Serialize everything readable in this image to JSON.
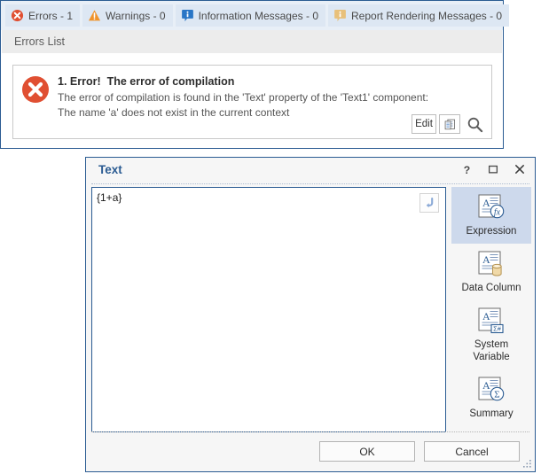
{
  "errors_panel": {
    "tabs": [
      {
        "id": "errors",
        "label": "Errors - 1",
        "icon": "error-circle-icon",
        "active": true
      },
      {
        "id": "warnings",
        "label": "Warnings - 0",
        "icon": "warning-triangle-icon",
        "active": false
      },
      {
        "id": "information",
        "label": "Information Messages - 0",
        "icon": "info-bubble-blue-icon",
        "active": false
      },
      {
        "id": "rendering",
        "label": "Report Rendering Messages - 0",
        "icon": "info-bubble-orange-icon",
        "active": false
      }
    ],
    "section_title": "Errors List",
    "error": {
      "title": "1. Error!  The error of compilation",
      "line1": "The error of compilation is found in the 'Text' property of the 'Text1' component:",
      "line2": "The name 'a' does not exist in the current context",
      "edit_label": "Edit",
      "copy_icon": "copy-document-icon",
      "find_icon": "magnifier-search-icon"
    }
  },
  "dialog": {
    "title": "Text",
    "help_glyph": "?",
    "maximize_glyph": "maximize-icon",
    "close_glyph": "close-icon",
    "editor": {
      "value": "{1+a}",
      "wrap_icon": "word-wrap-arrow-icon"
    },
    "tools": [
      {
        "id": "expression",
        "label": "Expression",
        "icon": "expression-fx-icon",
        "selected": true
      },
      {
        "id": "data-column",
        "label": "Data Column",
        "icon": "data-column-database-icon",
        "selected": false
      },
      {
        "id": "system-variable",
        "label": "System\nVariable",
        "icon": "system-variable-icon",
        "selected": false
      },
      {
        "id": "summary",
        "label": "Summary",
        "icon": "summary-sigma-icon",
        "selected": false
      }
    ],
    "buttons": {
      "ok": "OK",
      "cancel": "Cancel"
    }
  },
  "colors": {
    "accent_blue": "#2a5b92",
    "tab_active_bg": "#dde7f3",
    "error_red": "#e04f32",
    "warning_orange": "#f0932b",
    "info_blue": "#2a76c6",
    "render_tan": "#e8c07a",
    "tool_selected_bg": "#cdd9ec"
  }
}
